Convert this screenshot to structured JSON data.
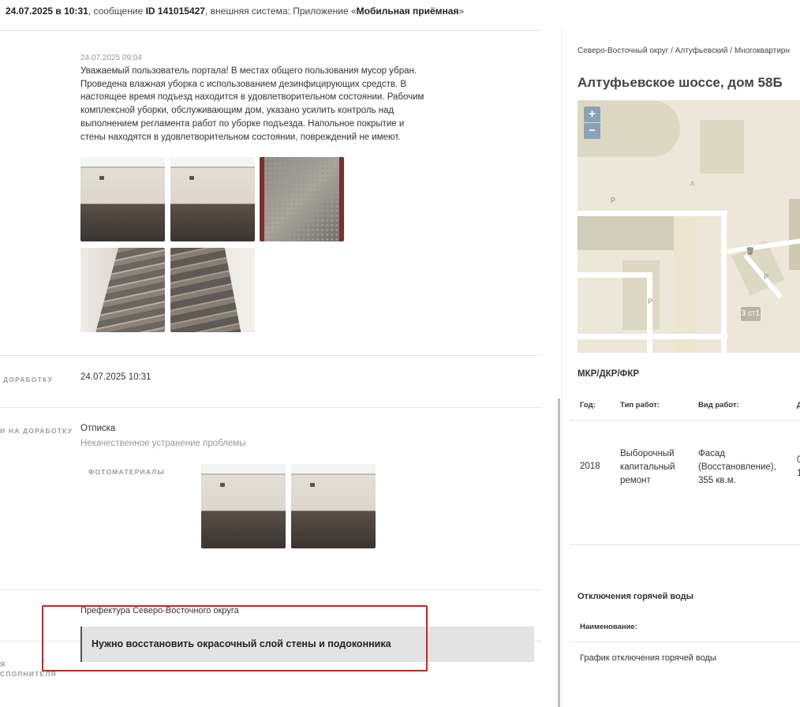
{
  "header": {
    "date_time": "24.07.2025 в 10:31",
    "msg_text": ", сообщение ",
    "message_id": "ID 141015427",
    "ext_text": ", внешняя система: Приложение «",
    "system_name": "Мобильная приёмная",
    "ext_close": "»"
  },
  "answer": {
    "date": "24.07.2025 09:04",
    "text": "Уважаемый пользователь портала! В местах общего пользования мусор убран. Проведена влажная уборка с использованием дезинфицирующих средств. В настоящее время подъезд находится в удовлетворительном состоянии. Рабочим комплексной уборки, обслуживающим дом, указано усилить контроль над выполнением регламента работ по уборке подъезда. Напольное покрытие и стены находятся в удовлетворительном состоянии, повреждений не имеют."
  },
  "rework": {
    "date_label": "ДОРАБОТКУ",
    "date_value": "24.07.2025 10:31",
    "reason_label": "И НА ДОРАБОТКУ",
    "reason_value": "Отписка",
    "reason_detail": "Некачественное устранение проблемы",
    "photos_label": "ФОТОМАТЕРИАЛЫ"
  },
  "org": {
    "value": "Префектура Северо-Восточного округа"
  },
  "executor": {
    "label_line1": "Я",
    "label_line2": "СПОЛНИТЕЛЯ",
    "comment": "Нужно восстановить окрасочный слой стены и подоконника"
  },
  "right": {
    "breadcrumb": "Северо-Восточный округ / Алтуфьевский / Многоквартирн",
    "address": "Алтуфьевское шоссе, дом 58Б",
    "map": {
      "zoom_in": "+",
      "zoom_out": "−",
      "building_badge": "3 ст1",
      "parking_symbol": "P"
    },
    "works": {
      "title": "МКР/ДКР/ФКР",
      "headers": [
        "Год:",
        "Тип работ:",
        "Вид работ:",
        "Д"
      ],
      "row": [
        "2018",
        "Выборочный капитальный ремонт",
        "Фасад (Восстановление), 355 кв.м.",
        "0 1"
      ]
    },
    "hot_water": {
      "title": "Отключения горячей воды",
      "header": "Наименование:",
      "item": "График отключения горячей воды"
    }
  },
  "icons": {
    "trash": "trash-icon",
    "warning": "warning-icon"
  }
}
